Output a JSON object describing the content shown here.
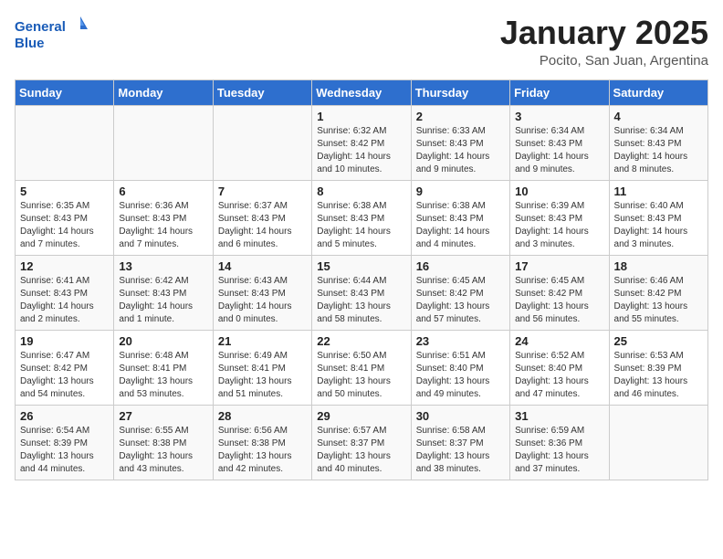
{
  "header": {
    "logo_general": "General",
    "logo_blue": "Blue",
    "month_title": "January 2025",
    "location": "Pocito, San Juan, Argentina"
  },
  "weekdays": [
    "Sunday",
    "Monday",
    "Tuesday",
    "Wednesday",
    "Thursday",
    "Friday",
    "Saturday"
  ],
  "weeks": [
    [
      {
        "day": "",
        "info": ""
      },
      {
        "day": "",
        "info": ""
      },
      {
        "day": "",
        "info": ""
      },
      {
        "day": "1",
        "info": "Sunrise: 6:32 AM\nSunset: 8:42 PM\nDaylight: 14 hours\nand 10 minutes."
      },
      {
        "day": "2",
        "info": "Sunrise: 6:33 AM\nSunset: 8:43 PM\nDaylight: 14 hours\nand 9 minutes."
      },
      {
        "day": "3",
        "info": "Sunrise: 6:34 AM\nSunset: 8:43 PM\nDaylight: 14 hours\nand 9 minutes."
      },
      {
        "day": "4",
        "info": "Sunrise: 6:34 AM\nSunset: 8:43 PM\nDaylight: 14 hours\nand 8 minutes."
      }
    ],
    [
      {
        "day": "5",
        "info": "Sunrise: 6:35 AM\nSunset: 8:43 PM\nDaylight: 14 hours\nand 7 minutes."
      },
      {
        "day": "6",
        "info": "Sunrise: 6:36 AM\nSunset: 8:43 PM\nDaylight: 14 hours\nand 7 minutes."
      },
      {
        "day": "7",
        "info": "Sunrise: 6:37 AM\nSunset: 8:43 PM\nDaylight: 14 hours\nand 6 minutes."
      },
      {
        "day": "8",
        "info": "Sunrise: 6:38 AM\nSunset: 8:43 PM\nDaylight: 14 hours\nand 5 minutes."
      },
      {
        "day": "9",
        "info": "Sunrise: 6:38 AM\nSunset: 8:43 PM\nDaylight: 14 hours\nand 4 minutes."
      },
      {
        "day": "10",
        "info": "Sunrise: 6:39 AM\nSunset: 8:43 PM\nDaylight: 14 hours\nand 3 minutes."
      },
      {
        "day": "11",
        "info": "Sunrise: 6:40 AM\nSunset: 8:43 PM\nDaylight: 14 hours\nand 3 minutes."
      }
    ],
    [
      {
        "day": "12",
        "info": "Sunrise: 6:41 AM\nSunset: 8:43 PM\nDaylight: 14 hours\nand 2 minutes."
      },
      {
        "day": "13",
        "info": "Sunrise: 6:42 AM\nSunset: 8:43 PM\nDaylight: 14 hours\nand 1 minute."
      },
      {
        "day": "14",
        "info": "Sunrise: 6:43 AM\nSunset: 8:43 PM\nDaylight: 14 hours\nand 0 minutes."
      },
      {
        "day": "15",
        "info": "Sunrise: 6:44 AM\nSunset: 8:43 PM\nDaylight: 13 hours\nand 58 minutes."
      },
      {
        "day": "16",
        "info": "Sunrise: 6:45 AM\nSunset: 8:42 PM\nDaylight: 13 hours\nand 57 minutes."
      },
      {
        "day": "17",
        "info": "Sunrise: 6:45 AM\nSunset: 8:42 PM\nDaylight: 13 hours\nand 56 minutes."
      },
      {
        "day": "18",
        "info": "Sunrise: 6:46 AM\nSunset: 8:42 PM\nDaylight: 13 hours\nand 55 minutes."
      }
    ],
    [
      {
        "day": "19",
        "info": "Sunrise: 6:47 AM\nSunset: 8:42 PM\nDaylight: 13 hours\nand 54 minutes."
      },
      {
        "day": "20",
        "info": "Sunrise: 6:48 AM\nSunset: 8:41 PM\nDaylight: 13 hours\nand 53 minutes."
      },
      {
        "day": "21",
        "info": "Sunrise: 6:49 AM\nSunset: 8:41 PM\nDaylight: 13 hours\nand 51 minutes."
      },
      {
        "day": "22",
        "info": "Sunrise: 6:50 AM\nSunset: 8:41 PM\nDaylight: 13 hours\nand 50 minutes."
      },
      {
        "day": "23",
        "info": "Sunrise: 6:51 AM\nSunset: 8:40 PM\nDaylight: 13 hours\nand 49 minutes."
      },
      {
        "day": "24",
        "info": "Sunrise: 6:52 AM\nSunset: 8:40 PM\nDaylight: 13 hours\nand 47 minutes."
      },
      {
        "day": "25",
        "info": "Sunrise: 6:53 AM\nSunset: 8:39 PM\nDaylight: 13 hours\nand 46 minutes."
      }
    ],
    [
      {
        "day": "26",
        "info": "Sunrise: 6:54 AM\nSunset: 8:39 PM\nDaylight: 13 hours\nand 44 minutes."
      },
      {
        "day": "27",
        "info": "Sunrise: 6:55 AM\nSunset: 8:38 PM\nDaylight: 13 hours\nand 43 minutes."
      },
      {
        "day": "28",
        "info": "Sunrise: 6:56 AM\nSunset: 8:38 PM\nDaylight: 13 hours\nand 42 minutes."
      },
      {
        "day": "29",
        "info": "Sunrise: 6:57 AM\nSunset: 8:37 PM\nDaylight: 13 hours\nand 40 minutes."
      },
      {
        "day": "30",
        "info": "Sunrise: 6:58 AM\nSunset: 8:37 PM\nDaylight: 13 hours\nand 38 minutes."
      },
      {
        "day": "31",
        "info": "Sunrise: 6:59 AM\nSunset: 8:36 PM\nDaylight: 13 hours\nand 37 minutes."
      },
      {
        "day": "",
        "info": ""
      }
    ]
  ]
}
